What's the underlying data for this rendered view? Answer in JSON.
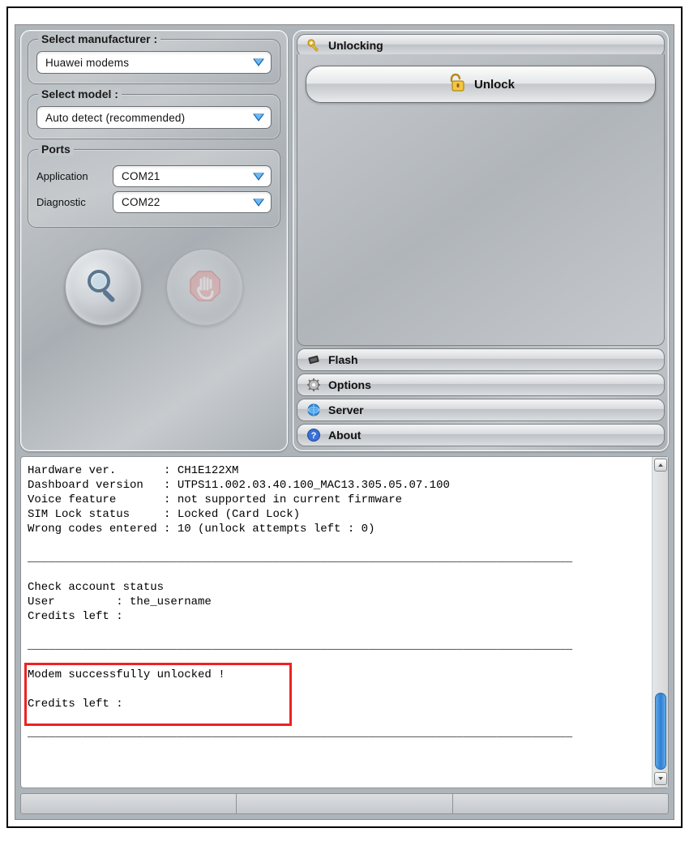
{
  "left": {
    "manufacturer": {
      "title": "Select manufacturer :",
      "value": "Huawei modems"
    },
    "model": {
      "title": "Select model :",
      "value": "Auto detect (recommended)"
    },
    "ports": {
      "title": "Ports",
      "application_label": "Application",
      "application_value": "COM21",
      "diagnostic_label": "Diagnostic",
      "diagnostic_value": "COM22"
    }
  },
  "right": {
    "sections": {
      "unlocking": "Unlocking",
      "flash": "Flash",
      "options": "Options",
      "server": "Server",
      "about": "About"
    },
    "unlock_button": "Unlock"
  },
  "log": "Hardware ver.       : CH1E122XM\nDashboard version   : UTPS11.002.03.40.100_MAC13.305.05.07.100\nVoice feature       : not supported in current firmware\nSIM Lock status     : Locked (Card Lock)\nWrong codes entered : 10 (unlock attempts left : 0)\n\n________________________________________________________________________________\n\nCheck account status\nUser         : the_username\nCredits left :\n\n________________________________________________________________________________\n\nModem successfully unlocked !\n\nCredits left :\n\n________________________________________________________________________________"
}
